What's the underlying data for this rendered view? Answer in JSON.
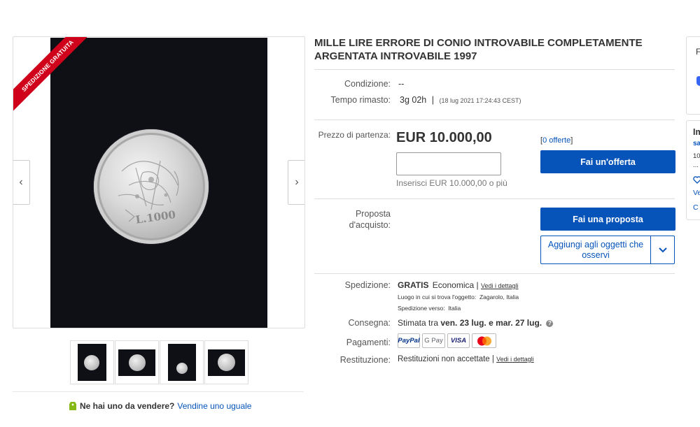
{
  "gallery": {
    "ribbon": "SPEDIZIONE GRATUITA",
    "prev": "‹",
    "next": "›",
    "coin_mark": "L.1000"
  },
  "sell": {
    "question": "Ne hai uno da vendere?",
    "link": "Vendine uno uguale"
  },
  "item": {
    "title": "MILLE LIRE ERRORE DI CONIO INTROVABILE COMPLETAMENTE ARGENTATA INTROVABILE 1997",
    "condition_label": "Condizione:",
    "condition_value": "--",
    "time_label": "Tempo rimasto:",
    "time_value": "3g 02h",
    "time_sep": "|",
    "time_detail": "(18 lug 2021  17:24:43 CEST)",
    "price_label": "Prezzo di partenza:",
    "price": "EUR 10.000,00",
    "offers_open": "[",
    "offers_link": "0 offerte",
    "offers_close": "]",
    "bid_button": "Fai un'offerta",
    "bid_hint": "Inserisci EUR 10.000,00 o più",
    "proposal_label_1": "Proposta",
    "proposal_label_2": "d'acquisto:",
    "proposal_button": "Fai una proposta",
    "watch_label": "Aggiungi agli oggetti che osservi"
  },
  "shipping": {
    "label": "Spedizione:",
    "free": "GRATIS",
    "method": "Economica",
    "sep": "|",
    "details_link": "Vedi i dettagli",
    "location_label": "Luogo in cui si trova l'oggetto:",
    "location": "Zagarolo, Italia",
    "ships_to_label": "Spedizione verso:",
    "ships_to": "Italia"
  },
  "delivery": {
    "label": "Consegna:",
    "prefix": "Stimata tra",
    "range": "ven. 23 lug. e mar. 27 lug.",
    "help": "?"
  },
  "payments": {
    "label": "Pagamenti:",
    "methods": [
      "PayPal",
      "G Pay",
      "VISA",
      "Mastercard"
    ]
  },
  "returns": {
    "label": "Restituzione:",
    "value": "Restituzioni non accettate",
    "sep": "|",
    "details_link": "Vedi i dettagli"
  },
  "side": {
    "card1_initial": "F",
    "card2_initial": "Im",
    "card2_line2": "sa",
    "card2_line3": "10",
    "card2_line4": "...",
    "card2_link": "Ve",
    "card2_last": "C"
  },
  "colors": {
    "link": "#0654ba",
    "button": "#0654ba",
    "ribbon": "#d0021b"
  }
}
